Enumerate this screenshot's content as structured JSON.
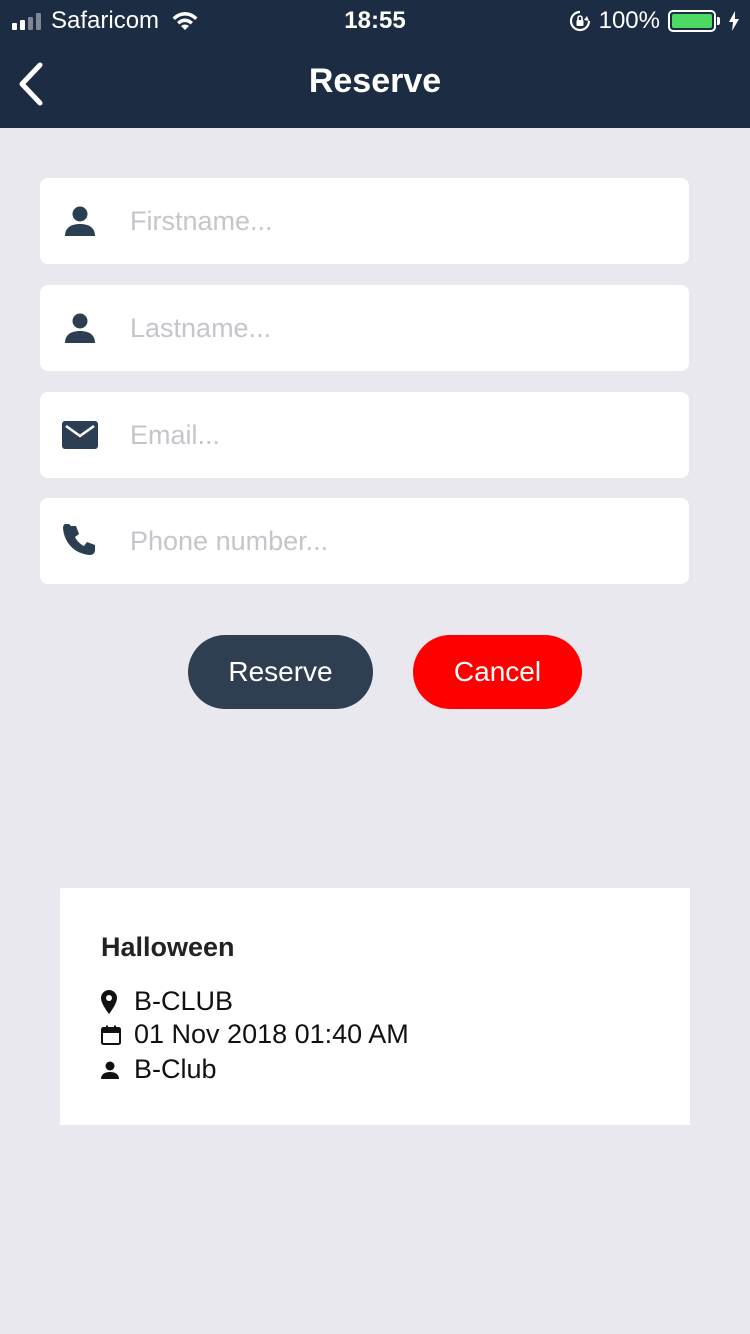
{
  "status_bar": {
    "carrier": "Safaricom",
    "time": "18:55",
    "battery_percent": "100%",
    "battery_color": "#4cd964",
    "icons": [
      "signal-icon",
      "wifi-icon",
      "orientation-lock-icon",
      "battery-icon",
      "charging-icon"
    ]
  },
  "header": {
    "title": "Reserve",
    "background": "#1c2c42",
    "back_icon": "chevron-left-icon"
  },
  "form": {
    "firstname": {
      "placeholder": "Firstname...",
      "value": "",
      "icon": "person-icon"
    },
    "lastname": {
      "placeholder": "Lastname...",
      "value": "",
      "icon": "person-icon"
    },
    "email": {
      "placeholder": "Email...",
      "value": "",
      "icon": "mail-icon"
    },
    "phone": {
      "placeholder": "Phone number...",
      "value": "",
      "icon": "phone-icon"
    }
  },
  "actions": {
    "reserve_label": "Reserve",
    "reserve_color": "#2f3e50",
    "cancel_label": "Cancel",
    "cancel_color": "#ff0000"
  },
  "event": {
    "title": "Halloween",
    "venue": "B-CLUB",
    "datetime": "01 Nov 2018 01:40 AM",
    "organizer": "B-Club",
    "icons": [
      "location-pin-icon",
      "calendar-icon",
      "user-icon"
    ]
  }
}
